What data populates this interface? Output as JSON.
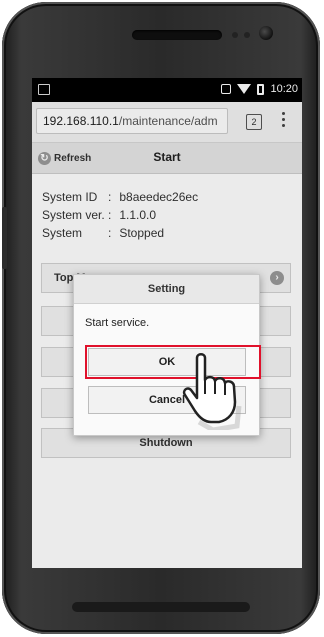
{
  "status_bar": {
    "time": "10:20"
  },
  "browser": {
    "url_host": "192.168.110.1",
    "url_path": "/maintenance/adm",
    "tab_count": "2"
  },
  "app_bar": {
    "refresh_label": "Refresh",
    "title": "Start"
  },
  "system_info": [
    {
      "key": "System ID",
      "sep": ":",
      "value": "b8aeedec26ec"
    },
    {
      "key": "System ver.",
      "sep": ":",
      "value": "1.1.0.0"
    },
    {
      "key": "System",
      "sep": ":",
      "value": "Stopped"
    }
  ],
  "menu": {
    "top_menu_label": "Top Menu",
    "shutdown_label": "Shutdown"
  },
  "dialog": {
    "title": "Setting",
    "message": "Start service.",
    "ok_label": "OK",
    "cancel_label": "Cancel"
  },
  "colors": {
    "highlight": "#e0112b",
    "accent_gray": "#999999"
  },
  "icons": [
    "refresh-icon",
    "chevron-right-icon",
    "pointing-hand-icon",
    "wifi-icon",
    "battery-icon",
    "vibrate-icon",
    "overflow-menu-icon"
  ]
}
